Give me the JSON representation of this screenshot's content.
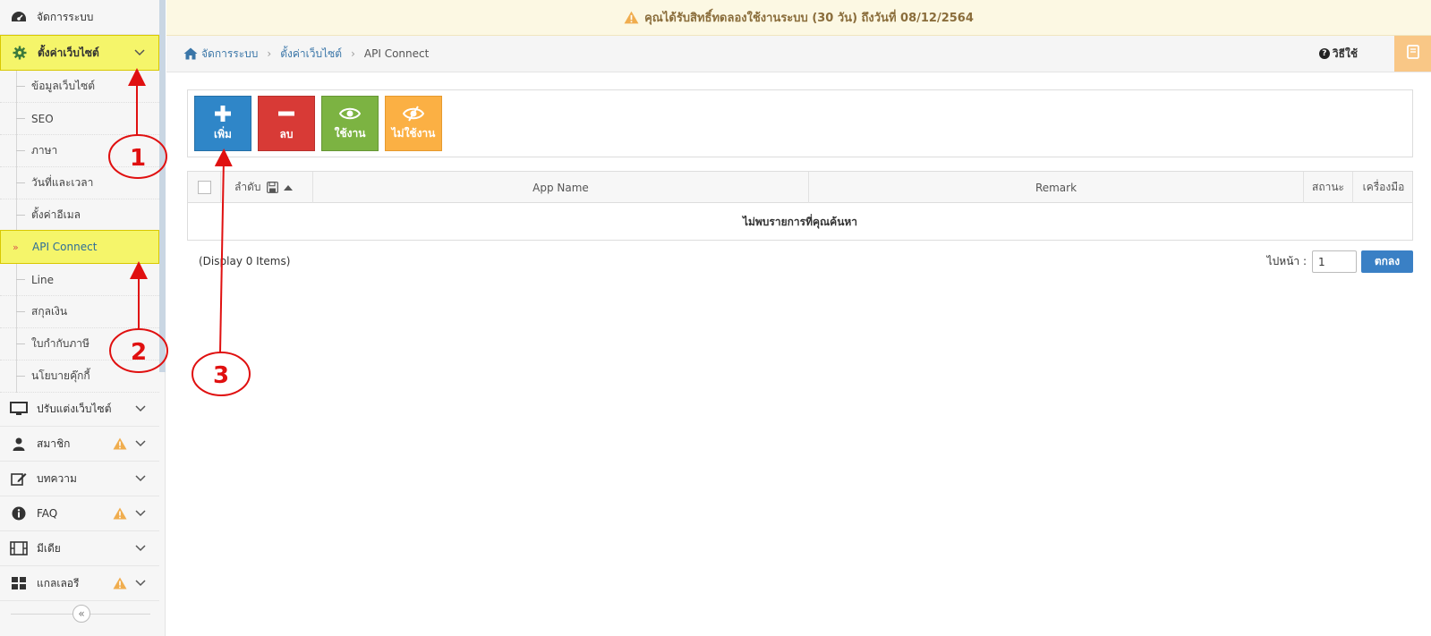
{
  "notice": {
    "text": "คุณได้รับสิทธิ์ทดลองใช้งานระบบ (30 วัน) ถึงวันที่ 08/12/2564"
  },
  "sidebar": {
    "top_item": "จัดการระบบ",
    "settings": "ตั้งค่าเว็บไซต์",
    "sub_items": [
      "ข้อมูลเว็บไซต์",
      "SEO",
      "ภาษา",
      "วันที่และเวลา",
      "ตั้งค่าอีเมล",
      "API Connect",
      "Line",
      "สกุลเงิน",
      "ใบกำกับภาษี",
      "นโยบายคุ๊กกี้"
    ],
    "sub_arrow": "»",
    "menu": [
      "ปรับแต่งเว็บไซต์",
      "สมาชิก",
      "บทความ",
      "FAQ",
      "มีเดีย",
      "แกลเลอรี"
    ],
    "collapse_icon": "«"
  },
  "breadcrumb": {
    "home": "จัดการระบบ",
    "section": "ตั้งค่าเว็บไซต์",
    "separator": "›",
    "current": "API Connect"
  },
  "help": {
    "icon": "?",
    "label": "วิธีใช้"
  },
  "toolbar": {
    "add": "เพิ่ม",
    "delete": "ลบ",
    "enable": "ใช้งาน",
    "disable": "ไม่ใช้งาน"
  },
  "table": {
    "columns": {
      "seq": "ลำดับ",
      "app_name": "App Name",
      "remark": "Remark",
      "status": "สถานะ",
      "tools": "เครื่องมือ"
    },
    "empty": "ไม่พบรายการที่คุณค้นหา"
  },
  "footer": {
    "display": "(Display 0 Items)",
    "goto_label": "ไปหน้า :",
    "page_value": "1",
    "go_button": "ตกลง"
  },
  "annotations": [
    "1",
    "2",
    "3"
  ],
  "colors": {
    "highlight": "#f5f56a",
    "annotation_red": "#e01010",
    "add_blue": "#2f86c8",
    "delete_red": "#d83a36",
    "enable_green": "#7cb342",
    "disable_orange": "#fbb044",
    "link_blue": "#3a76a8",
    "warning": "#f0ad4e"
  }
}
